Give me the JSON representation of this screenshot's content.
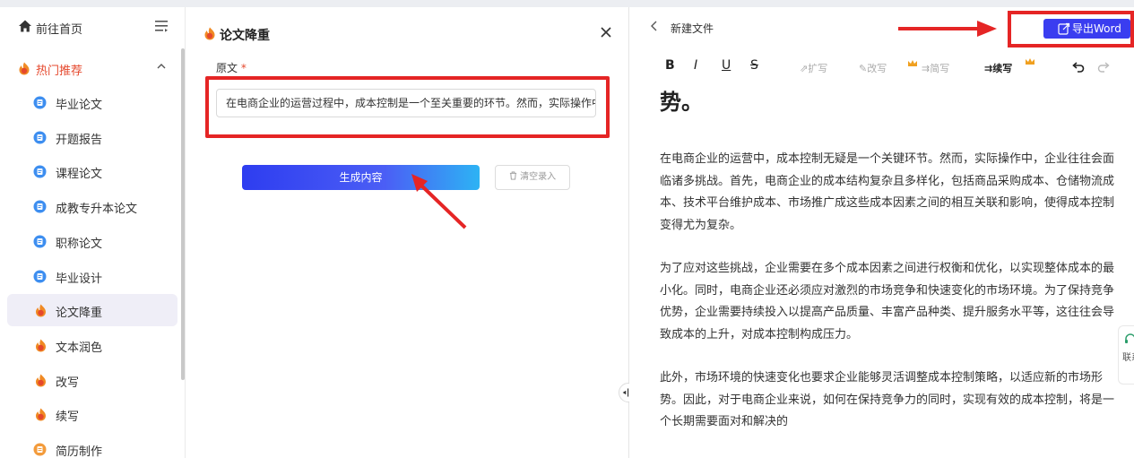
{
  "sidebar": {
    "home_label": "前往首页",
    "group_label": "热门推荐",
    "items": [
      {
        "label": "毕业论文",
        "icon": "doc-icon"
      },
      {
        "label": "开题报告",
        "icon": "doc-icon"
      },
      {
        "label": "课程论文",
        "icon": "doc-icon"
      },
      {
        "label": "成教专升本论文",
        "icon": "doc-icon"
      },
      {
        "label": "职称论文",
        "icon": "doc-icon"
      },
      {
        "label": "毕业设计",
        "icon": "doc-icon"
      },
      {
        "label": "论文降重",
        "icon": "flame-icon",
        "active": true
      },
      {
        "label": "文本润色",
        "icon": "flame-icon"
      },
      {
        "label": "改写",
        "icon": "flame-icon"
      },
      {
        "label": "续写",
        "icon": "flame-icon"
      },
      {
        "label": "简历制作",
        "icon": "resume-icon"
      }
    ]
  },
  "middle": {
    "title": "论文降重",
    "original_label": "原文",
    "required_mark": "*",
    "original_value": "在电商企业的运营过程中，成本控制是一个至关重要的环节。然而，实际操作中，企业往往面临诸多挑战",
    "generate_label": "生成内容",
    "clear_label": "清空录入"
  },
  "editor": {
    "doc_name": "新建文件",
    "export_label": "导出Word",
    "toolbar": {
      "bold": "B",
      "italic": "I",
      "underline": "U",
      "strike": "S",
      "expand": "扩写",
      "rewrite": "改写",
      "simplify": "简写",
      "continue": "续写"
    },
    "heading_tail": "势。",
    "paragraphs": [
      "在电商企业的运营中，成本控制无疑是一个关键环节。然而，实际操作中，企业往往会面临诸多挑战。首先，电商企业的成本结构复杂且多样化，包括商品采购成本、仓储物流成本、技术平台维护成本、市场推广成这些成本因素之间的相互关联和影响，使得成本控制变得尤为复杂。",
      "为了应对这些挑战，企业需要在多个成本因素之间进行权衡和优化，以实现整体成本的最小化。同时，电商企业还必须应对激烈的市场竞争和快速变化的市场环境。为了保持竞争优势，企业需要持续投入以提高产品质量、丰富产品种类、提升服务水平等，这往往会导致成本的上升，对成本控制构成压力。",
      "此外，市场环境的快速变化也要求企业能够灵活调整成本控制策略，以适应新的市场形势。因此，对于电商企业来说，如何在保持竞争力的同时，实现有效的成本控制，将是一个长期需要面对和解决的"
    ]
  },
  "contact": {
    "label": "联系客服"
  },
  "colors": {
    "accent": "#3a3df0",
    "annotation": "#e52525",
    "brand_orange": "#e5482d"
  }
}
